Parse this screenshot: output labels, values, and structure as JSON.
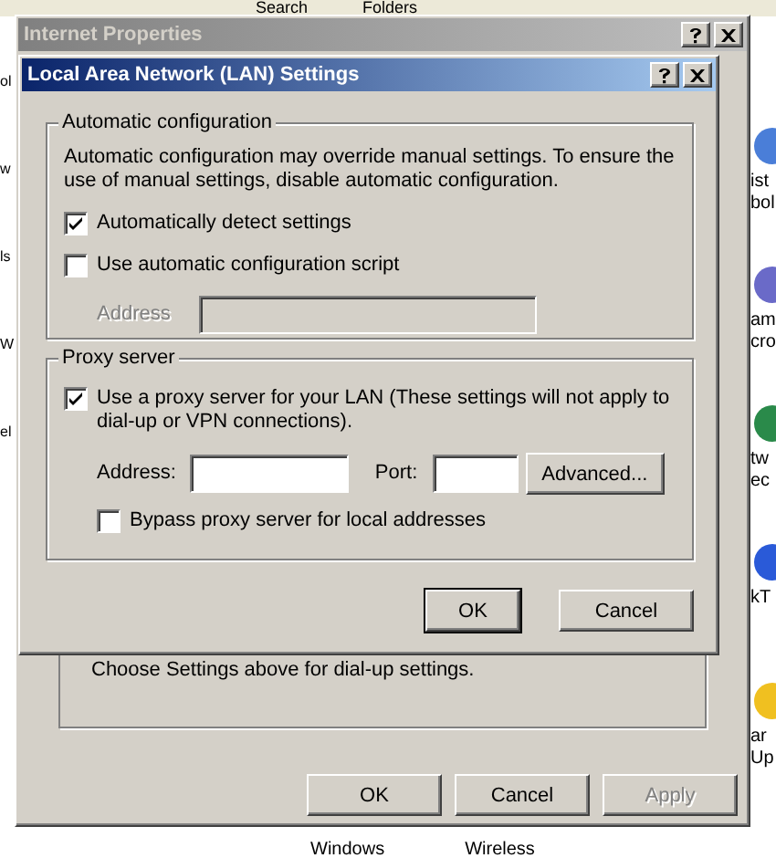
{
  "background_toolbar": {
    "buttons": [
      {
        "label": "Search"
      },
      {
        "label": "Folders"
      }
    ]
  },
  "left_fragments": [
    "ol",
    "w",
    "ls",
    "W",
    "el"
  ],
  "desktop_icons": [
    {
      "lines": [
        "ist",
        "bol"
      ]
    },
    {
      "lines": [
        "am",
        "cro"
      ]
    },
    {
      "lines": [
        "tw",
        "ec"
      ]
    },
    {
      "lines": [
        "kT"
      ]
    },
    {
      "lines": [
        "ar",
        "Up"
      ]
    }
  ],
  "bottom_labels": [
    "Windows",
    "Wireless"
  ],
  "internet_properties": {
    "title": "Internet Properties",
    "active": false,
    "note": "Choose Settings above for dial-up settings.",
    "buttons": [
      {
        "label": "OK",
        "disabled": false
      },
      {
        "label": "Cancel",
        "disabled": false
      },
      {
        "label": "Apply",
        "disabled": true
      }
    ]
  },
  "lan_dialog": {
    "title": "Local Area Network (LAN) Settings",
    "active": true,
    "automatic": {
      "legend": "Automatic configuration",
      "description": "Automatic configuration may override manual settings.  To ensure the use of manual settings, disable automatic configuration.",
      "options": [
        {
          "label": "Automatically detect settings",
          "checked": true
        },
        {
          "label": "Use automatic configuration script",
          "checked": false
        }
      ],
      "address": {
        "label": "Address",
        "disabled": true
      }
    },
    "proxy": {
      "legend": "Proxy server",
      "use_proxy": {
        "label": "Use a proxy server for your LAN (These settings will not apply to dial-up or VPN connections).",
        "checked": true
      },
      "address_label": "Address:",
      "port_label": "Port:",
      "advanced": "Advanced...",
      "bypass": {
        "label": "Bypass proxy server for local addresses",
        "checked": false
      }
    },
    "buttons": [
      {
        "label": "OK",
        "default": true
      },
      {
        "label": "Cancel",
        "default": false
      }
    ]
  }
}
